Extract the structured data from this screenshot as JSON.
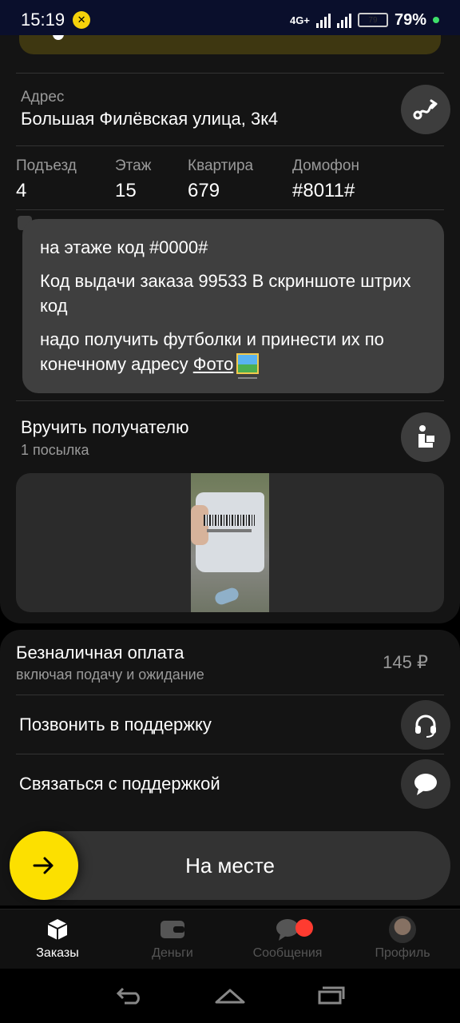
{
  "status_bar": {
    "time": "15:19",
    "network": "4G+",
    "battery_level": "79",
    "battery_percent": "79%"
  },
  "address": {
    "label": "Адрес",
    "value": "Большая Филёвская улица, 3к4"
  },
  "details": [
    {
      "label": "Подъезд",
      "value": "4"
    },
    {
      "label": "Этаж",
      "value": "15"
    },
    {
      "label": "Квартира",
      "value": "679"
    },
    {
      "label": "Домофон",
      "value": "#8011#"
    }
  ],
  "comment": {
    "line1": "на этаже код #0000#",
    "line2": "Код выдачи заказа 99533 В скриншоте штрих код",
    "line3": "надо получить футболки и принести их по конечному адресу",
    "photo_link": "Фото"
  },
  "delivery": {
    "title": "Вручить получателю",
    "subtitle": "1 посылка"
  },
  "payment": {
    "title": "Безналичная оплата",
    "subtitle": "включая подачу и ожидание",
    "amount": "145 ₽"
  },
  "support": {
    "call_label": "Позвонить в поддержку",
    "chat_label": "Связаться с поддержкой"
  },
  "slider": {
    "label": "На месте"
  },
  "tabs": [
    {
      "label": "Заказы",
      "icon": "box-icon",
      "active": true
    },
    {
      "label": "Деньги",
      "icon": "wallet-icon",
      "active": false
    },
    {
      "label": "Сообщения",
      "icon": "chat-bubble-icon",
      "active": false
    },
    {
      "label": "Профиль",
      "icon": "avatar",
      "active": false
    }
  ],
  "colors": {
    "accent_yellow": "#fce000",
    "badge_red": "#ff3b30",
    "surface": "#141414",
    "comment_bg": "#3f3f3f"
  }
}
